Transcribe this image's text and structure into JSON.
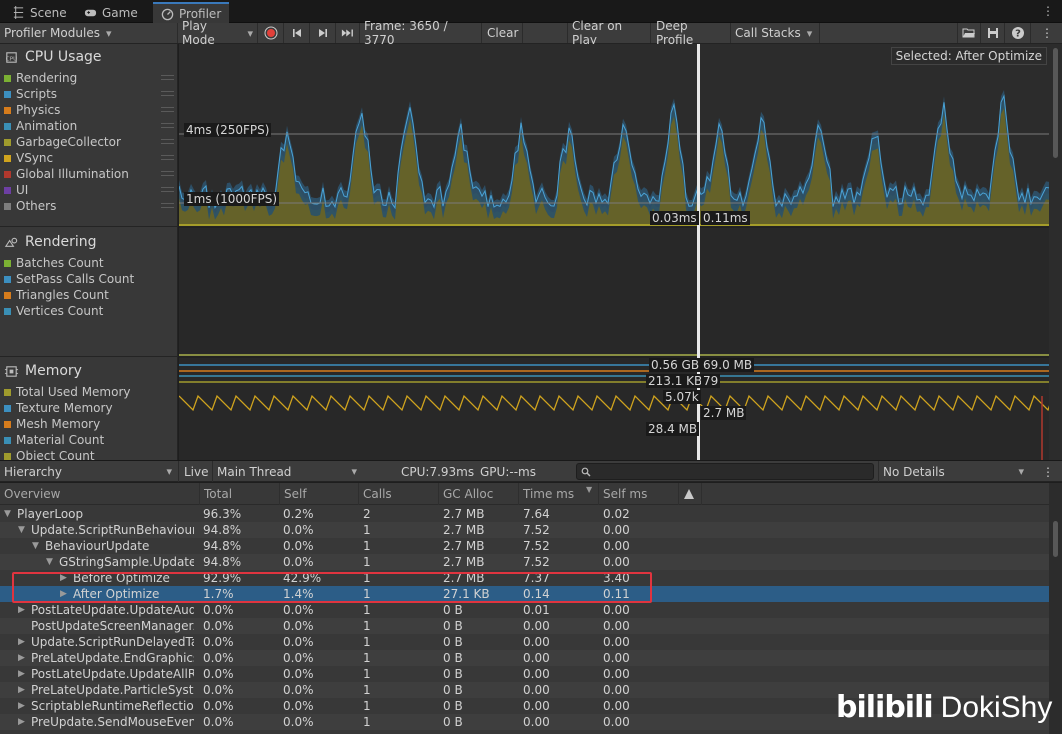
{
  "tabs": [
    {
      "label": "Scene",
      "icon": "scene-icon"
    },
    {
      "label": "Game",
      "icon": "gamepad-icon"
    },
    {
      "label": "Profiler",
      "icon": "profiler-icon",
      "active": true
    }
  ],
  "toolbar": {
    "modules_label": "Profiler Modules",
    "play_mode_label": "Play Mode",
    "frame_label": "Frame: 3650 / 3770",
    "clear_label": "Clear",
    "clear_on_play_label": "Clear on Play",
    "deep_profile_label": "Deep Profile",
    "call_stacks_label": "Call Stacks"
  },
  "modules": [
    {
      "title": "CPU Usage",
      "icon": "cpu-icon",
      "items": [
        {
          "label": "Rendering",
          "color": "#7bb033"
        },
        {
          "label": "Scripts",
          "color": "#3c8fc0"
        },
        {
          "label": "Physics",
          "color": "#d67c1c"
        },
        {
          "label": "Animation",
          "color": "#3a8fb5"
        },
        {
          "label": "GarbageCollector",
          "color": "#9f9b2d"
        },
        {
          "label": "VSync",
          "color": "#cfa31e"
        },
        {
          "label": "Global Illumination",
          "color": "#b0382d"
        },
        {
          "label": "UI",
          "color": "#6d3fa3"
        },
        {
          "label": "Others",
          "color": "#7d7d7d"
        }
      ]
    },
    {
      "title": "Rendering",
      "icon": "rendering-icon",
      "items": [
        {
          "label": "Batches Count",
          "color": "#7bb033"
        },
        {
          "label": "SetPass Calls Count",
          "color": "#3c8fc0"
        },
        {
          "label": "Triangles Count",
          "color": "#d67c1c"
        },
        {
          "label": "Vertices Count",
          "color": "#3a8fb5"
        }
      ]
    },
    {
      "title": "Memory",
      "icon": "memory-icon",
      "items": [
        {
          "label": "Total Used Memory",
          "color": "#9f9b2d"
        },
        {
          "label": "Texture Memory",
          "color": "#3c8fc0"
        },
        {
          "label": "Mesh Memory",
          "color": "#d67c1c"
        },
        {
          "label": "Material Count",
          "color": "#3a8fb5"
        },
        {
          "label": "Object Count",
          "color": "#9f9b2d"
        }
      ]
    }
  ],
  "chart": {
    "selected_label": "Selected: After Optimize",
    "line_4ms": "4ms (250FPS)",
    "line_1ms": "1ms (1000FPS)",
    "cpu_value_left": "0.03ms",
    "cpu_value_right": "0.11ms",
    "mem_labels": [
      "0.56 GB",
      "69.0 MB",
      "213.1 KB",
      "79",
      "5.07k",
      "2.7 MB",
      "28.4 MB"
    ]
  },
  "hierarchy_bar": {
    "view_label": "Hierarchy",
    "live_label": "Live",
    "thread_label": "Main Thread",
    "cpu_label": "CPU:7.93ms",
    "gpu_label": "GPU:--ms",
    "details_label": "No Details"
  },
  "columns": [
    "Overview",
    "Total",
    "Self",
    "Calls",
    "GC Alloc",
    "Time ms",
    "Self ms"
  ],
  "rows": [
    {
      "name": "PlayerLoop",
      "indent": 0,
      "expanded": true,
      "total": "96.3%",
      "self": "0.2%",
      "calls": "2",
      "gc": "2.7 MB",
      "time": "7.64",
      "selfms": "0.02"
    },
    {
      "name": "Update.ScriptRunBehaviourU",
      "indent": 1,
      "expanded": true,
      "total": "94.8%",
      "self": "0.0%",
      "calls": "1",
      "gc": "2.7 MB",
      "time": "7.52",
      "selfms": "0.00"
    },
    {
      "name": "BehaviourUpdate",
      "indent": 2,
      "expanded": true,
      "total": "94.8%",
      "self": "0.0%",
      "calls": "1",
      "gc": "2.7 MB",
      "time": "7.52",
      "selfms": "0.00"
    },
    {
      "name": "GStringSample.Update()",
      "indent": 3,
      "expanded": true,
      "total": "94.8%",
      "self": "0.0%",
      "calls": "1",
      "gc": "2.7 MB",
      "time": "7.52",
      "selfms": "0.00"
    },
    {
      "name": "Before Optimize",
      "indent": 4,
      "expanded": false,
      "total": "92.9%",
      "self": "42.9%",
      "calls": "1",
      "gc": "2.7 MB",
      "time": "7.37",
      "selfms": "3.40"
    },
    {
      "name": "After Optimize",
      "indent": 4,
      "expanded": false,
      "total": "1.7%",
      "self": "1.4%",
      "calls": "1",
      "gc": "27.1 KB",
      "time": "0.14",
      "selfms": "0.11",
      "selected": true
    },
    {
      "name": "PostLateUpdate.UpdateAudio",
      "indent": 1,
      "expanded": false,
      "total": "0.0%",
      "self": "0.0%",
      "calls": "1",
      "gc": "0 B",
      "time": "0.01",
      "selfms": "0.00"
    },
    {
      "name": "PostUpdateScreenManagerAi",
      "indent": 1,
      "expanded": null,
      "total": "0.0%",
      "self": "0.0%",
      "calls": "1",
      "gc": "0 B",
      "time": "0.00",
      "selfms": "0.00"
    },
    {
      "name": "Update.ScriptRunDelayedTas",
      "indent": 1,
      "expanded": false,
      "total": "0.0%",
      "self": "0.0%",
      "calls": "1",
      "gc": "0 B",
      "time": "0.00",
      "selfms": "0.00"
    },
    {
      "name": "PreLateUpdate.EndGraphicsJ",
      "indent": 1,
      "expanded": false,
      "total": "0.0%",
      "self": "0.0%",
      "calls": "1",
      "gc": "0 B",
      "time": "0.00",
      "selfms": "0.00"
    },
    {
      "name": "PostLateUpdate.UpdateAllRe",
      "indent": 1,
      "expanded": false,
      "total": "0.0%",
      "self": "0.0%",
      "calls": "1",
      "gc": "0 B",
      "time": "0.00",
      "selfms": "0.00"
    },
    {
      "name": "PreLateUpdate.ParticleSyster",
      "indent": 1,
      "expanded": false,
      "total": "0.0%",
      "self": "0.0%",
      "calls": "1",
      "gc": "0 B",
      "time": "0.00",
      "selfms": "0.00"
    },
    {
      "name": "ScriptableRuntimeReflectionS",
      "indent": 1,
      "expanded": false,
      "total": "0.0%",
      "self": "0.0%",
      "calls": "1",
      "gc": "0 B",
      "time": "0.00",
      "selfms": "0.00"
    },
    {
      "name": "PreUpdate.SendMouseEvents",
      "indent": 1,
      "expanded": false,
      "total": "0.0%",
      "self": "0.0%",
      "calls": "1",
      "gc": "0 B",
      "time": "0.00",
      "selfms": "0.00"
    }
  ],
  "watermark": {
    "logo": "bilibili",
    "user": "DokiShy"
  }
}
